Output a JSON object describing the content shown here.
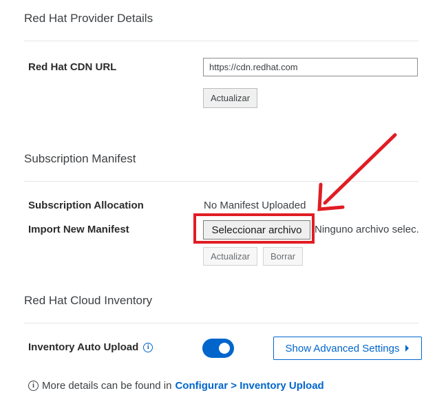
{
  "provider": {
    "section_title": "Red Hat Provider Details",
    "cdn_label": "Red Hat CDN URL",
    "cdn_value": "https://cdn.redhat.com",
    "update_label": "Actualizar"
  },
  "manifest": {
    "section_title": "Subscription Manifest",
    "allocation_label": "Subscription Allocation",
    "allocation_value": "No Manifest Uploaded",
    "import_label": "Import New Manifest",
    "choose_file_label": "Seleccionar archivo",
    "no_file_text": "Ninguno archivo selec.",
    "update_label": "Actualizar",
    "delete_label": "Borrar"
  },
  "inventory": {
    "section_title": "Red Hat Cloud Inventory",
    "auto_upload_label": "Inventory Auto Upload",
    "auto_upload_enabled": true,
    "advanced_settings_label": "Show Advanced Settings",
    "details_text": "More details can be found in",
    "details_link": "Configurar > Inventory Upload"
  },
  "annotation": {
    "highlight_color": "#e01d24"
  },
  "colors": {
    "accent": "#0066cc"
  }
}
